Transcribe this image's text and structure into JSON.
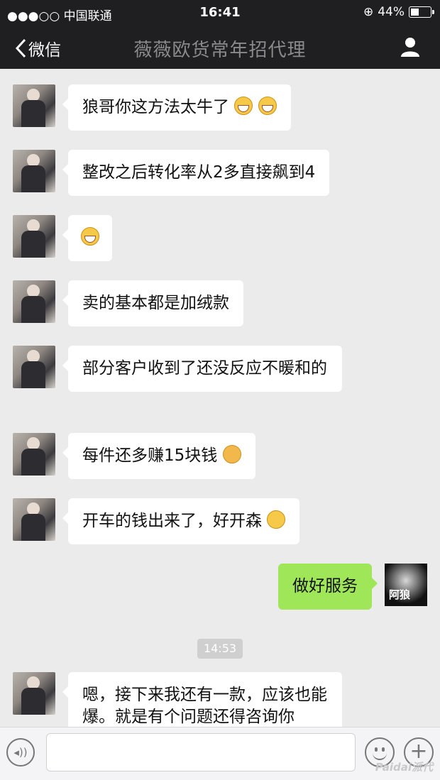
{
  "status_bar": {
    "carrier": "●●●○○ 中国联通",
    "time": "16:41",
    "battery": "44%"
  },
  "nav": {
    "back_label": "微信",
    "title": "薇薇欧货常年招代理"
  },
  "messages": [
    {
      "from": "other",
      "text": "狼哥你这方法太牛了"
    },
    {
      "from": "other",
      "text": "整改之后转化率从2多直接飙到4"
    },
    {
      "from": "other",
      "text": ""
    },
    {
      "from": "other",
      "text": "卖的基本都是加绒款"
    },
    {
      "from": "other",
      "text": "部分客户收到了还没反应不暖和的"
    },
    {
      "from": "other",
      "text": "每件还多赚15块钱"
    },
    {
      "from": "other",
      "text": "开车的钱出来了，好开森"
    },
    {
      "from": "me",
      "text": "做好服务"
    },
    {
      "from": "other",
      "text": "嗯，接下来我还有一款，应该也能爆。就是有个问题还得咨询你"
    }
  ],
  "timestamp": "14:53",
  "my_avatar_text": "阿狼",
  "watermark": "Paidai派代"
}
